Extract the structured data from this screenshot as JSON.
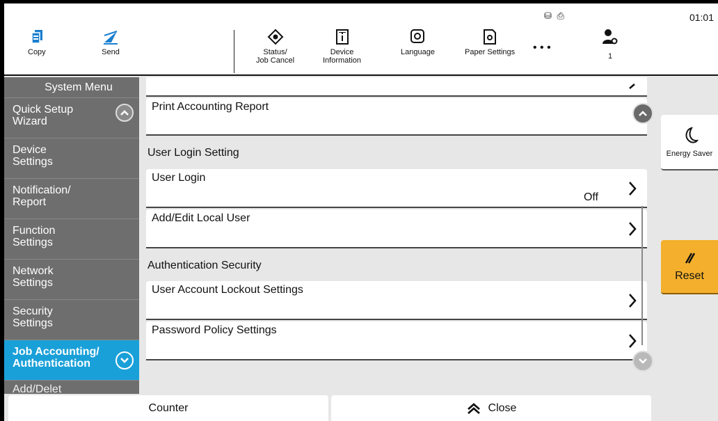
{
  "topbar": {
    "clock": "01:01",
    "status_icons": "⛁ ⎙",
    "buttons": {
      "copy": "Copy",
      "send": "Send",
      "status_line1": "Status/",
      "status_line2": "Job Cancel",
      "device_line1": "Device",
      "device_line2": "Information",
      "language": "Language",
      "paper_settings": "Paper Settings",
      "more": "• • •",
      "user_count": "1"
    }
  },
  "sidebar": {
    "title": "System Menu",
    "items": [
      {
        "line1": "Quick Setup",
        "line2": "Wizard"
      },
      {
        "line1": "Device",
        "line2": "Settings"
      },
      {
        "line1": "Notification/",
        "line2": "Report"
      },
      {
        "line1": "Function",
        "line2": "Settings"
      },
      {
        "line1": "Network",
        "line2": "Settings"
      },
      {
        "line1": "Security",
        "line2": "Settings"
      },
      {
        "line1": "Job Accounting/",
        "line2": "Authentication"
      }
    ],
    "partial_item": "Add/Delet"
  },
  "main": {
    "rows": {
      "print_accounting_report": "Print Accounting Report",
      "user_login": "User Login",
      "user_login_value": "Off",
      "add_edit_local_user": "Add/Edit Local User",
      "user_account_lockout": "User Account Lockout Settings",
      "password_policy": "Password Policy Settings"
    },
    "sections": {
      "user_login_setting": "User Login Setting",
      "authentication_security": "Authentication Security"
    }
  },
  "right_panel": {
    "energy_saver": "Energy Saver",
    "reset": "Reset"
  },
  "bottombar": {
    "counter": "Counter",
    "close": "Close"
  },
  "colors": {
    "accent_blue": "#1aa0d8",
    "reset_orange": "#f4b02d",
    "sidebar_gray": "#6e6e6e"
  }
}
